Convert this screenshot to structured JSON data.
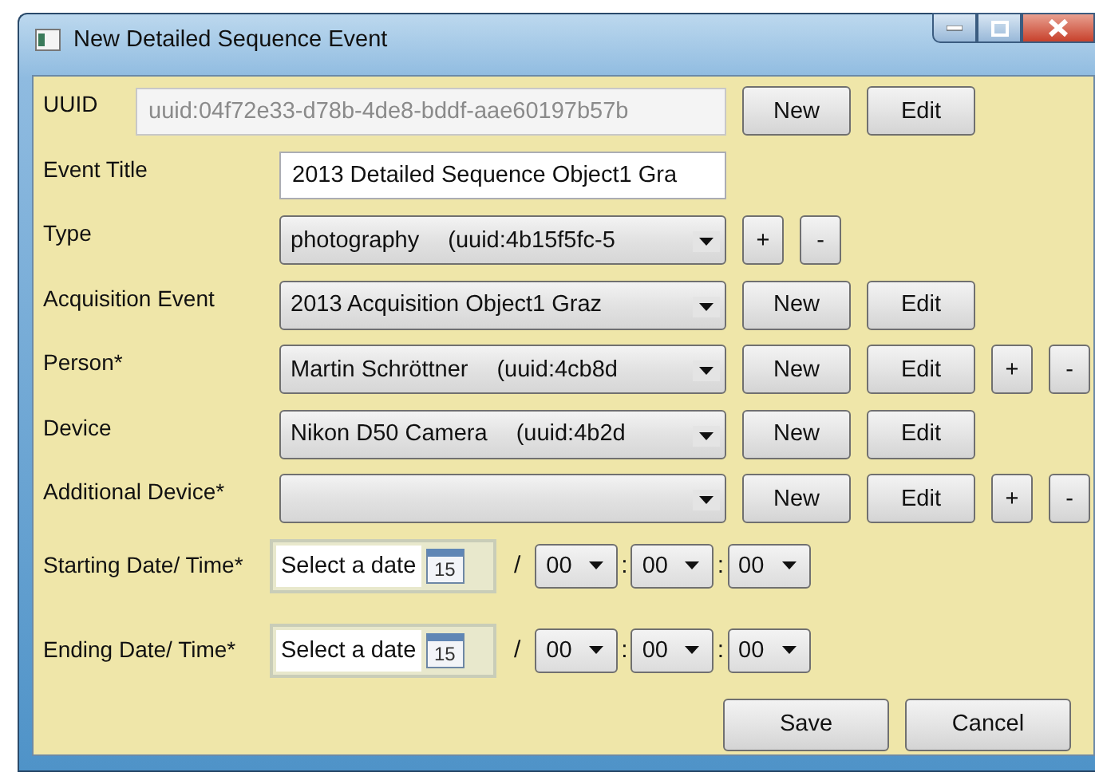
{
  "window": {
    "title": "New Detailed Sequence Event"
  },
  "rows": [
    {
      "kind": "text",
      "label": "UUID",
      "value": "uuid:04f72e33-d78b-4de8-bddf-aae60197b57b",
      "disabled": true,
      "buttons": [
        {
          "label": "New",
          "kind": "wide"
        },
        {
          "label": "Edit",
          "kind": "wide"
        }
      ]
    },
    {
      "kind": "text",
      "label": "Event Title",
      "value": "2013 Detailed Sequence Object1 Gra",
      "disabled": false,
      "buttons": []
    },
    {
      "kind": "combo",
      "label": "Type",
      "value": "photography",
      "detail": "(uuid:4b15f5fc-5",
      "buttons": [
        {
          "label": "+",
          "kind": "small"
        },
        {
          "label": "-",
          "kind": "small"
        }
      ]
    },
    {
      "kind": "combo",
      "label": "Acquisition Event",
      "value": "2013 Acquisition Object1 Graz",
      "buttons": [
        {
          "label": "New",
          "kind": "wide"
        },
        {
          "label": "Edit",
          "kind": "wide"
        }
      ]
    },
    {
      "kind": "combo",
      "label": "Person*",
      "value": "Martin Schröttner",
      "detail": "(uuid:4cb8d",
      "buttons": [
        {
          "label": "New",
          "kind": "wide"
        },
        {
          "label": "Edit",
          "kind": "wide"
        },
        {
          "label": "+",
          "kind": "small"
        },
        {
          "label": "-",
          "kind": "small"
        }
      ]
    },
    {
      "kind": "combo",
      "label": "Device",
      "value": "Nikon D50 Camera",
      "detail": "(uuid:4b2d",
      "buttons": [
        {
          "label": "New",
          "kind": "wide"
        },
        {
          "label": "Edit",
          "kind": "wide"
        }
      ]
    },
    {
      "kind": "combo",
      "label": "Additional Device*",
      "buttons": [
        {
          "label": "New",
          "kind": "wide"
        },
        {
          "label": "Edit",
          "kind": "wide"
        },
        {
          "label": "+",
          "kind": "small"
        },
        {
          "label": "-",
          "kind": "small"
        }
      ]
    },
    {
      "kind": "datetime",
      "label": "Starting Date/ Time*",
      "placeholder": "Select a date",
      "calendar_day": "15",
      "separator": "/",
      "time": [
        "00",
        "00",
        "00"
      ],
      "time_separator": ":"
    },
    {
      "kind": "datetime",
      "label": "Ending Date/ Time*",
      "placeholder": "Select a date",
      "calendar_day": "15",
      "separator": "/",
      "time": [
        "00",
        "00",
        "00"
      ],
      "time_separator": ":"
    }
  ],
  "footer_buttons": [
    "Save",
    "Cancel"
  ]
}
